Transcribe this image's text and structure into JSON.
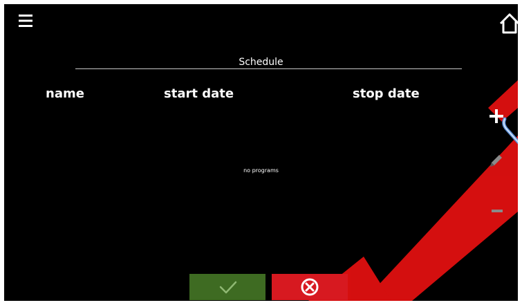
{
  "header": {
    "menu_icon": "hamburger-menu-icon",
    "home_icon": "home-icon"
  },
  "schedule": {
    "title": "Schedule",
    "columns": {
      "name": "name",
      "start_date": "start date",
      "stop_date": "stop date"
    },
    "empty_message": "no programs"
  },
  "side_actions": {
    "add_icon": "plus-icon",
    "edit_icon": "pencil-icon",
    "remove_icon": "minus-icon"
  },
  "footer": {
    "confirm_icon": "check-icon",
    "cancel_icon": "cancel-circle-x-icon",
    "confirm_color": "#3e6b22",
    "cancel_color": "#d71920"
  },
  "watermark_color": "#e01010"
}
